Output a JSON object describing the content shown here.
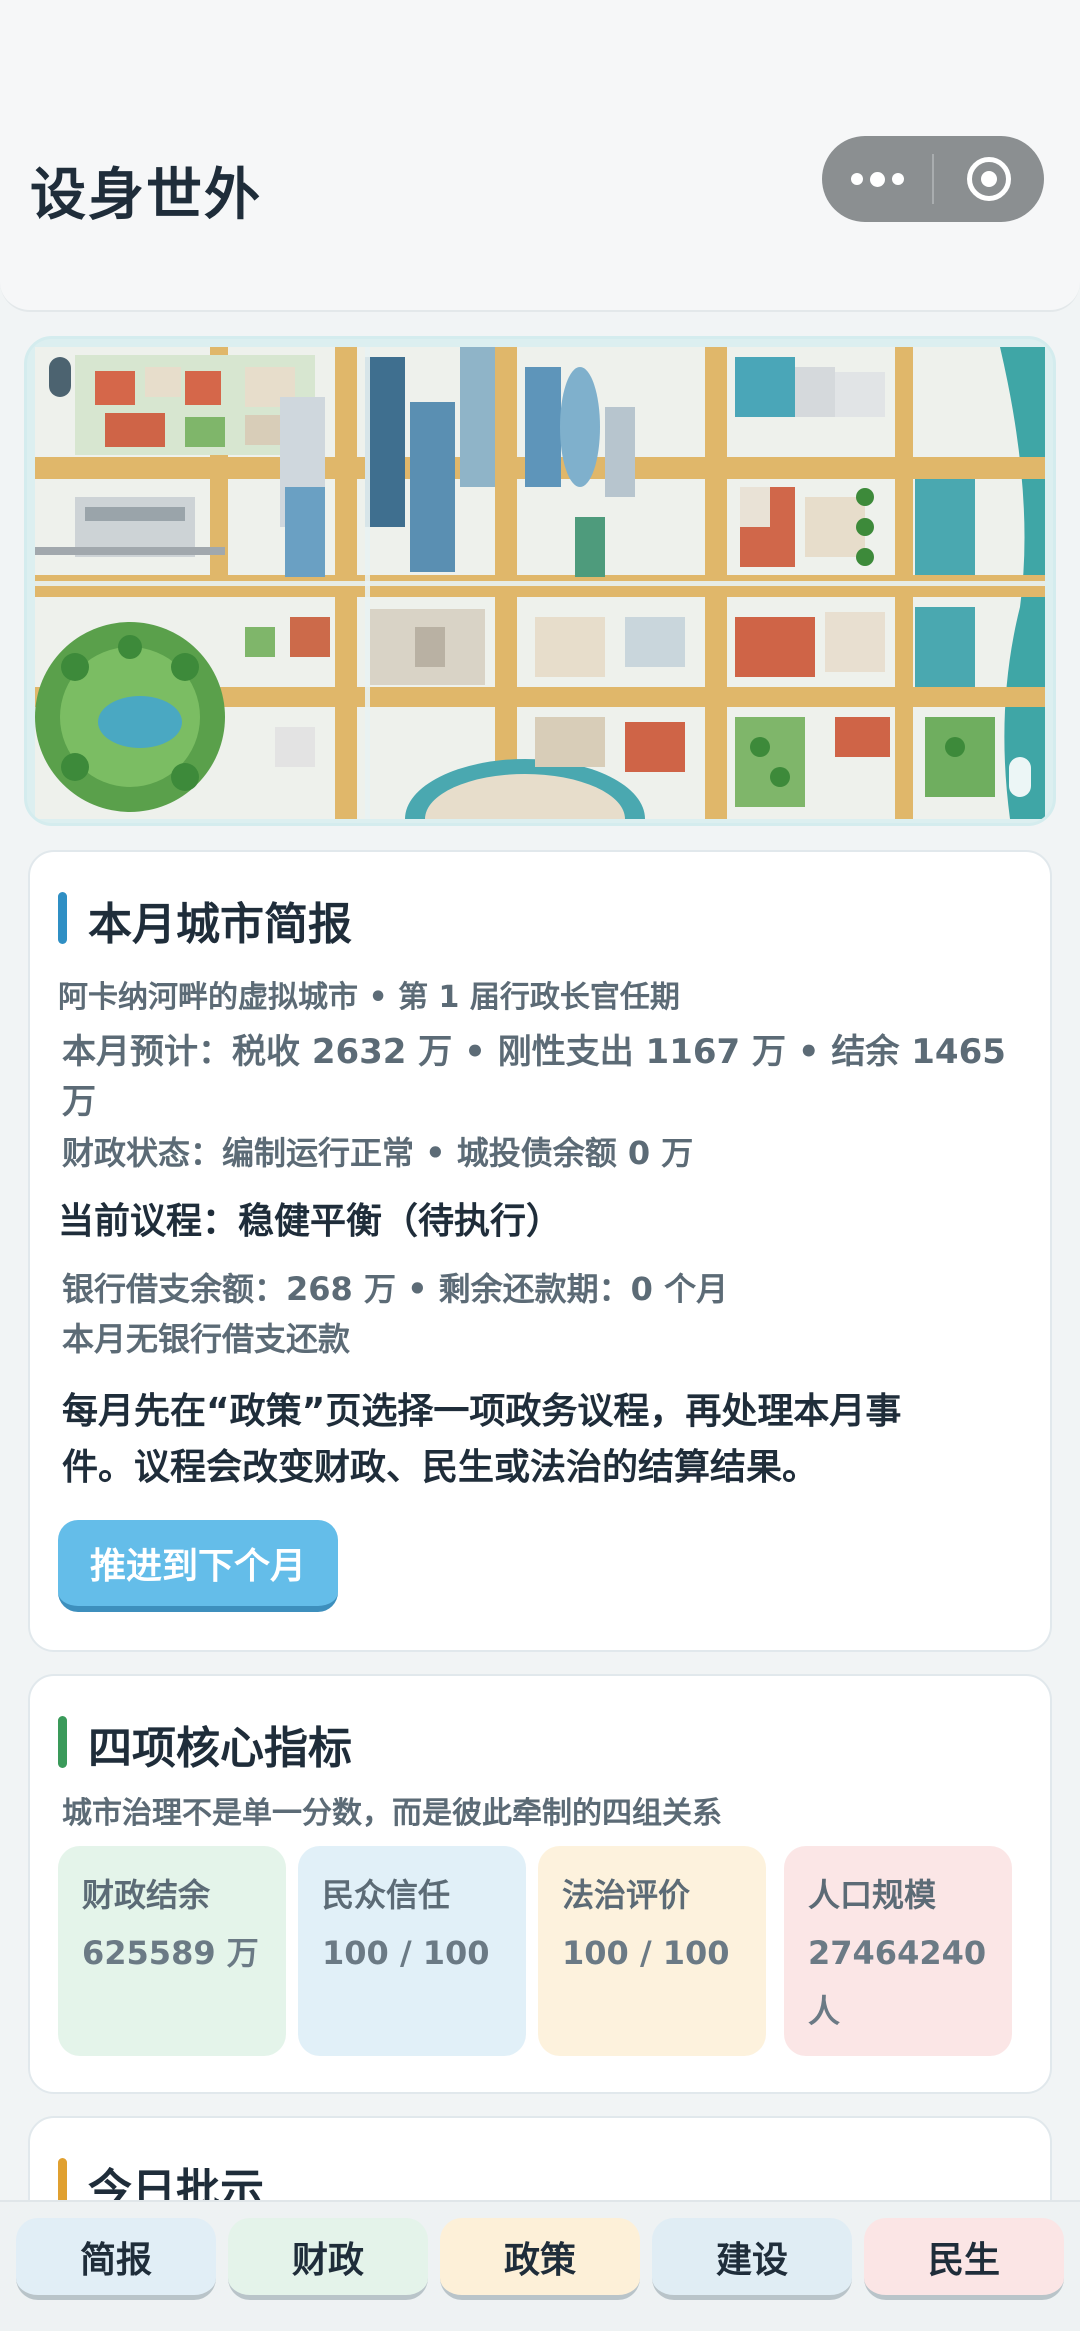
{
  "app": {
    "title": "设身世外"
  },
  "briefing": {
    "title": "本月城市简报",
    "subtitle": "阿卡纳河畔的虚拟城市 • 第 1 届行政长官任期",
    "forecast_line1": "本月预计：税收 2632 万 • 刚性支出 1167 万 • 结余 1465",
    "forecast_line2": "万",
    "fiscal_status": "财政状态：编制运行正常 • 城投债余额 0 万",
    "agenda": "当前议程：稳健平衡（待执行）",
    "bank_loan": "银行借支余额：268 万 • 剩余还款期：0 个月",
    "repayment": "本月无银行借支还款",
    "instruction_line1": "每月先在“政策”页选择一项政务议程，再处理本月事",
    "instruction_line2": "件。议程会改变财政、民生或法治的结算结果。",
    "advance_button": "推进到下个月"
  },
  "indicators": {
    "title": "四项核心指标",
    "subtitle": "城市治理不是单一分数，而是彼此牵制的四组关系",
    "items": [
      {
        "label": "财政结余",
        "value_line1": "625589 万",
        "value_line2": "",
        "color": "#e4f4ea"
      },
      {
        "label": "民众信任",
        "value_line1": "100 / 100",
        "value_line2": "",
        "color": "#e1f0f8"
      },
      {
        "label": "法治评价",
        "value_line1": "100 / 100",
        "value_line2": "",
        "color": "#fdf2dd"
      },
      {
        "label": "人口规模",
        "value_line1": "27464240",
        "value_line2": "人",
        "color": "#fbe6e6"
      }
    ]
  },
  "directives": {
    "title": "今日批示"
  },
  "tabs": [
    {
      "label": "简报",
      "color": "#e1eef6"
    },
    {
      "label": "财政",
      "color": "#e4f3ea"
    },
    {
      "label": "政策",
      "color": "#fdf0d8"
    },
    {
      "label": "建设",
      "color": "#e0edf4"
    },
    {
      "label": "民生",
      "color": "#fbe5e5"
    }
  ],
  "accent_colors": {
    "briefing": "#2f8fc4",
    "indicators": "#3a9a5a",
    "directives": "#e0a030",
    "button": "#64bde9"
  }
}
